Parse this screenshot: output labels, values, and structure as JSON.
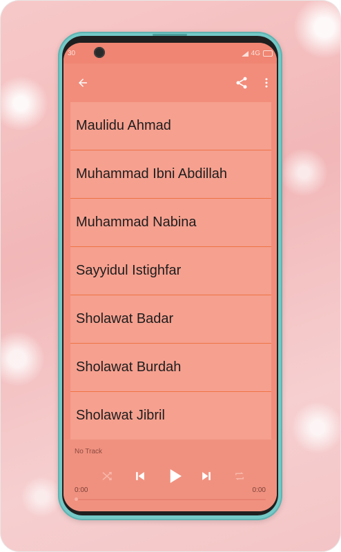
{
  "status": {
    "time": "30",
    "network": "4G"
  },
  "toolbar": {
    "back_icon": "arrow-left-icon",
    "share_icon": "share-icon",
    "more_icon": "more-vert-icon"
  },
  "songs": [
    {
      "title": "Maulidu Ahmad"
    },
    {
      "title": "Muhammad Ibni Abdillah"
    },
    {
      "title": "Muhammad Nabina"
    },
    {
      "title": "Sayyidul Istighfar"
    },
    {
      "title": "Sholawat Badar"
    },
    {
      "title": "Sholawat Burdah"
    },
    {
      "title": "Sholawat Jibril"
    }
  ],
  "player": {
    "track": "No Track",
    "elapsed": "0:00",
    "duration": "0:00",
    "progress": 0
  },
  "colors": {
    "accent": "#f28d7b",
    "list_bg": "#f6a08f",
    "divider": "#ee7345",
    "frame": "#74c9c7"
  }
}
